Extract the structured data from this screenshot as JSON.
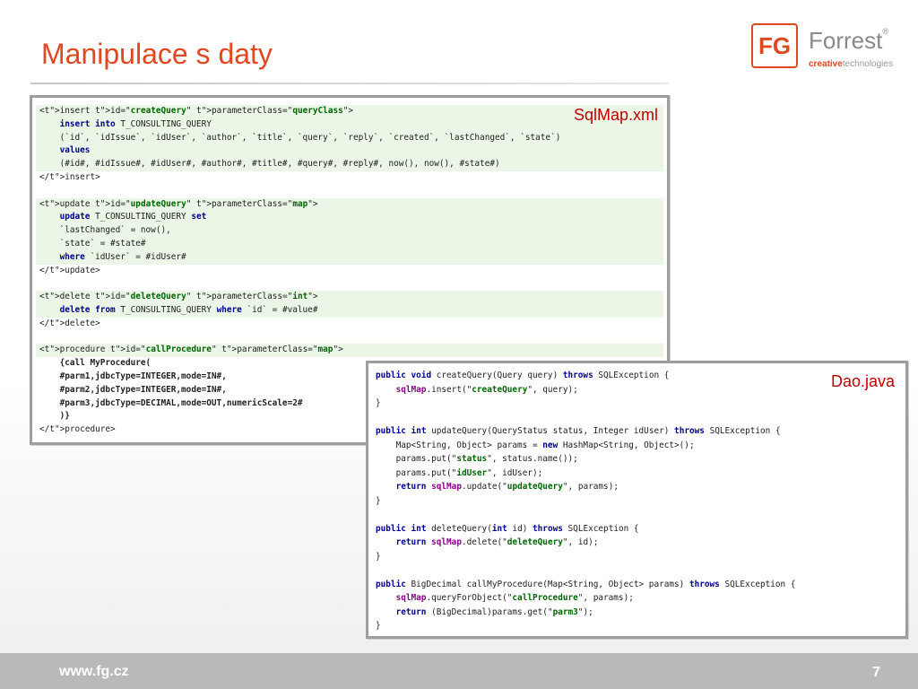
{
  "title": "Manipulace s daty",
  "logo": {
    "mark": "FG",
    "name": "Forrest",
    "reg": "®",
    "tag_a": "creative",
    "tag_b": "technologies"
  },
  "xml_panel": {
    "label": "SqlMap.xml",
    "lines": [
      "&lt;insert id=\"createQuery\" parameterClass=\"queryClass\"&gt;",
      "    insert into T_CONSULTING_QUERY",
      "    (`id`, `idIssue`, `idUser`, `author`, `title`, `query`, `reply`, `created`, `lastChanged`, `state`)",
      "    values",
      "    (#id#, #idIssue#, #idUser#, #author#, #title#, #query#, #reply#, now(), now(), #state#)",
      "&lt;/insert&gt;",
      "",
      "&lt;update id=\"updateQuery\" parameterClass=\"map\"&gt;",
      "    update T_CONSULTING_QUERY set",
      "    `lastChanged` = now(),",
      "    `state` = #state#",
      "    where `idUser` = #idUser#",
      "&lt;/update&gt;",
      "",
      "&lt;delete id=\"deleteQuery\" parameterClass=\"int\"&gt;",
      "    delete from T_CONSULTING_QUERY where `id` = #value#",
      "&lt;/delete&gt;",
      "",
      "&lt;procedure id=\"callProcedure\" parameterClass=\"map\"&gt;",
      "    {call MyProcedure(",
      "    #parm1,jdbcType=INTEGER,mode=IN#,",
      "    #parm2,jdbcType=INTEGER,mode=IN#,",
      "    #parm3,jdbcType=DECIMAL,mode=OUT,numericScale=2#",
      "    )}",
      "&lt;/procedure&gt;"
    ]
  },
  "java_panel": {
    "label": "Dao.java",
    "lines": [
      "public void createQuery(Query query) throws SQLException {",
      "    sqlMap.insert(\"createQuery\", query);",
      "}",
      "",
      "public int updateQuery(QueryStatus status, Integer idUser) throws SQLException {",
      "    Map<String, Object> params = new HashMap<String, Object>();",
      "    params.put(\"status\", status.name());",
      "    params.put(\"idUser\", idUser);",
      "    return sqlMap.update(\"updateQuery\", params);",
      "}",
      "",
      "public int deleteQuery(int id) throws SQLException {",
      "    return sqlMap.delete(\"deleteQuery\", id);",
      "}",
      "",
      "public BigDecimal callMyProcedure(Map<String, Object> params) throws SQLException {",
      "    sqlMap.queryForObject(\"callProcedure\", params);",
      "    return (BigDecimal)params.get(\"parm3\");",
      "}"
    ]
  },
  "footer": {
    "url": "www.fg.cz",
    "page": "7"
  }
}
